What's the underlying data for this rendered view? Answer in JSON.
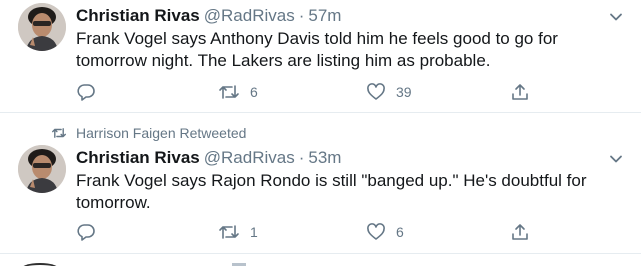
{
  "tweets": [
    {
      "display_name": "Christian Rivas",
      "handle": "@RadRivas",
      "separator": "·",
      "time": "57m",
      "text": "Frank Vogel says Anthony Davis told him he feels good to go for tomorrow night. The Lakers are listing him as probable.",
      "retweets": "6",
      "likes": "39"
    },
    {
      "retweet_context": "Harrison Faigen Retweeted",
      "display_name": "Christian Rivas",
      "handle": "@RadRivas",
      "separator": "·",
      "time": "53m",
      "text": "Frank Vogel says Rajon Rondo is still \"banged up.\" He's doubtful for tomorrow.",
      "retweets": "1",
      "likes": "6"
    }
  ],
  "icons": {
    "reply": "reply-icon",
    "retweet": "retweet-icon",
    "like": "heart-icon",
    "share": "share-icon",
    "caret": "chevron-down-icon"
  },
  "colors": {
    "text_primary": "#14171a",
    "text_secondary": "#657786",
    "divider": "#e6ecf0"
  }
}
